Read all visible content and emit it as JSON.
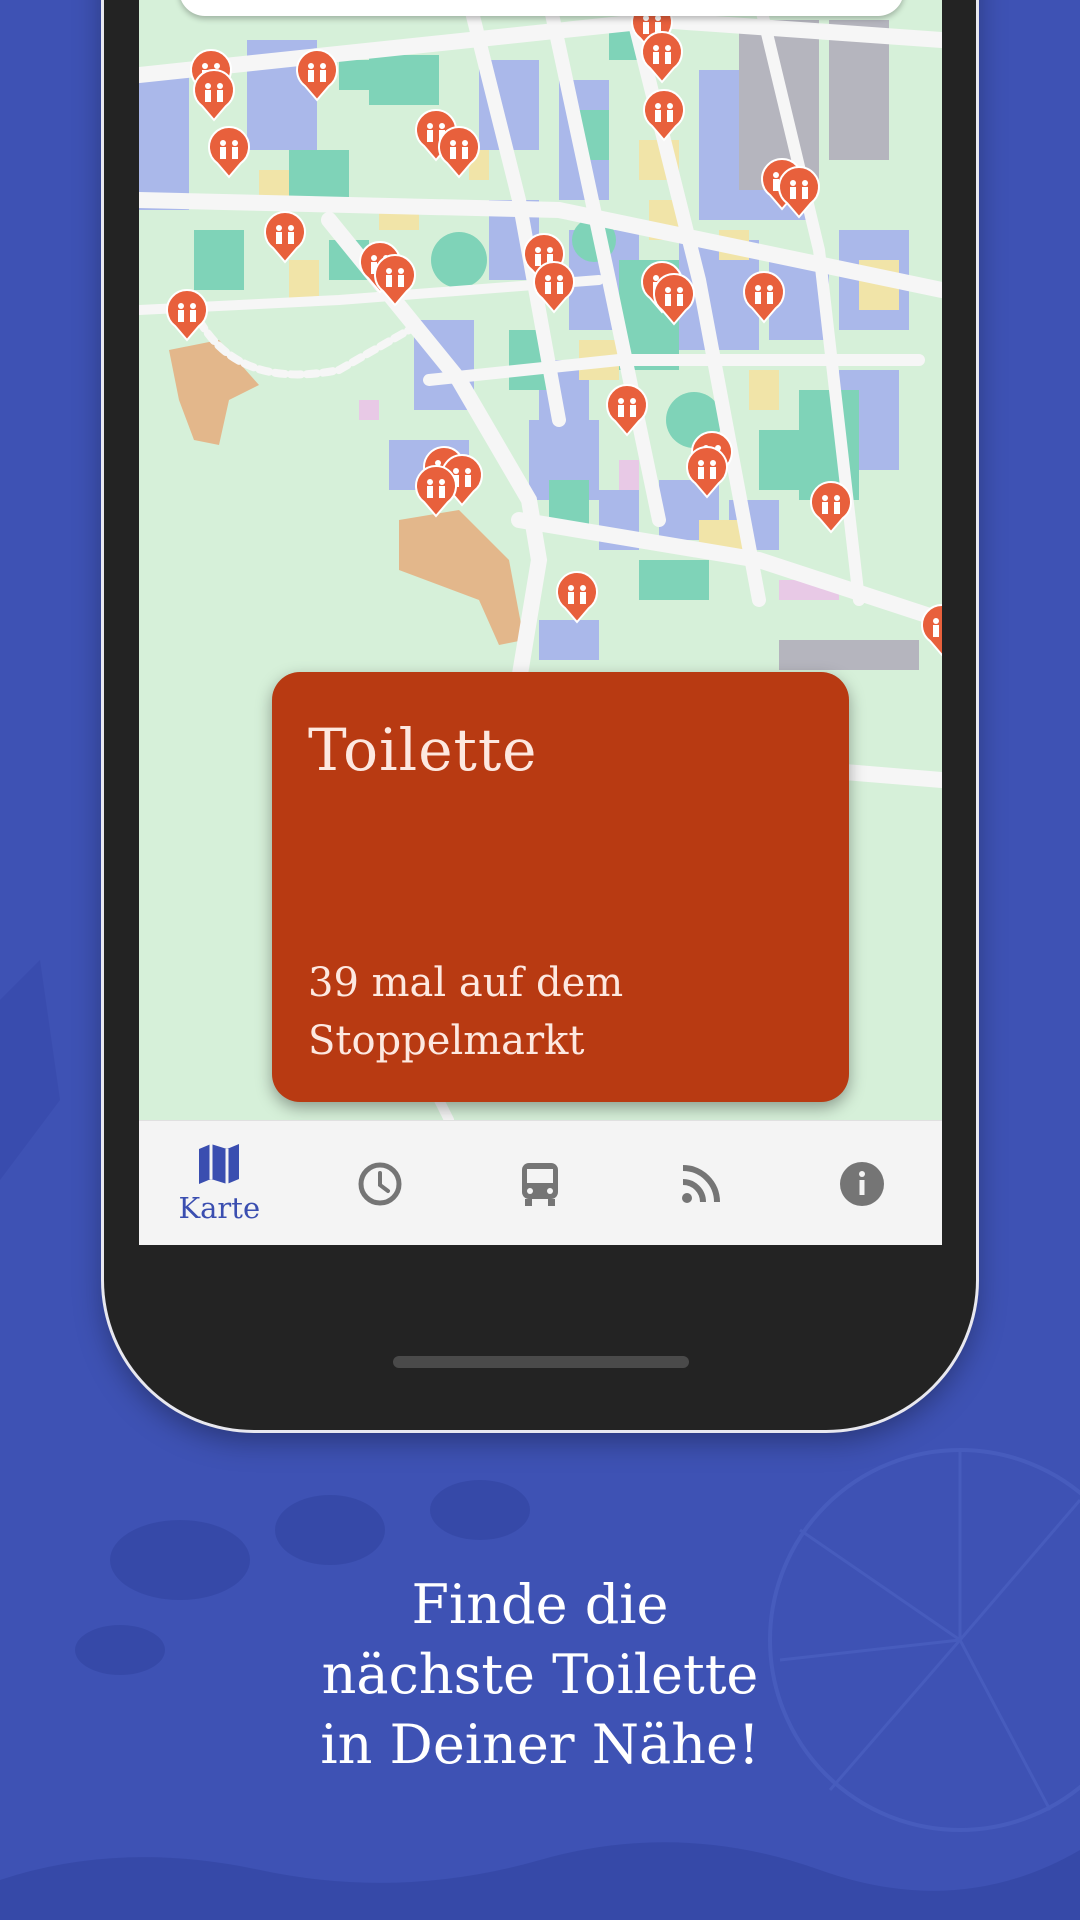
{
  "info_card": {
    "title": "Toilette",
    "description_line1": "39 mal auf dem",
    "description_line2": "Stoppelmarkt"
  },
  "bottom_nav": {
    "items": [
      {
        "icon": "map-icon",
        "label": "Karte",
        "active": true
      },
      {
        "icon": "clock-icon",
        "label": "",
        "active": false
      },
      {
        "icon": "bus-icon",
        "label": "",
        "active": false
      },
      {
        "icon": "rss-feed-icon",
        "label": "",
        "active": false
      },
      {
        "icon": "info-icon",
        "label": "",
        "active": false
      }
    ]
  },
  "map": {
    "marker_icon": "toilet-marker-icon",
    "marker_color": "#e8603c"
  },
  "caption": {
    "line1": "Finde die",
    "line2": "nächste Toilette",
    "line3": "in Deiner Nähe!"
  },
  "colors": {
    "background": "#3e52b4",
    "card": "#b83a12",
    "nav_active": "#3a4eb0",
    "nav_inactive": "#757575"
  }
}
